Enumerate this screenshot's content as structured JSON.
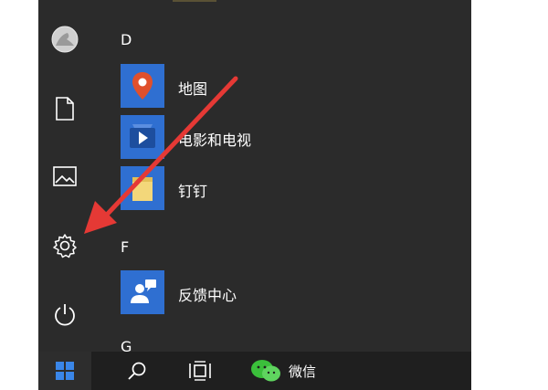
{
  "start_menu": {
    "sections": [
      {
        "letter": "D",
        "apps": [
          {
            "label": "地图",
            "icon": "map-pin-icon"
          },
          {
            "label": "电影和电视",
            "icon": "play-icon"
          },
          {
            "label": "钉钉",
            "icon": "folder-icon",
            "expandable": true
          }
        ]
      },
      {
        "letter": "F",
        "apps": [
          {
            "label": "反馈中心",
            "icon": "feedback-person-icon"
          }
        ]
      },
      {
        "letter": "G",
        "apps": []
      }
    ]
  },
  "left_rail": {
    "items": [
      "avatar",
      "document-icon",
      "pictures-icon",
      "settings-gear-icon",
      "power-icon"
    ]
  },
  "taskbar": {
    "wechat_label": "微信",
    "items": [
      "windows-start-icon",
      "search-icon",
      "task-view-icon",
      "wechat-icon"
    ]
  },
  "colors": {
    "menu_bg": "#2b2b2b",
    "taskbar_bg": "#1f1f1f",
    "tile_blue": "#2f6fd1",
    "annotation_red": "#e53935"
  }
}
